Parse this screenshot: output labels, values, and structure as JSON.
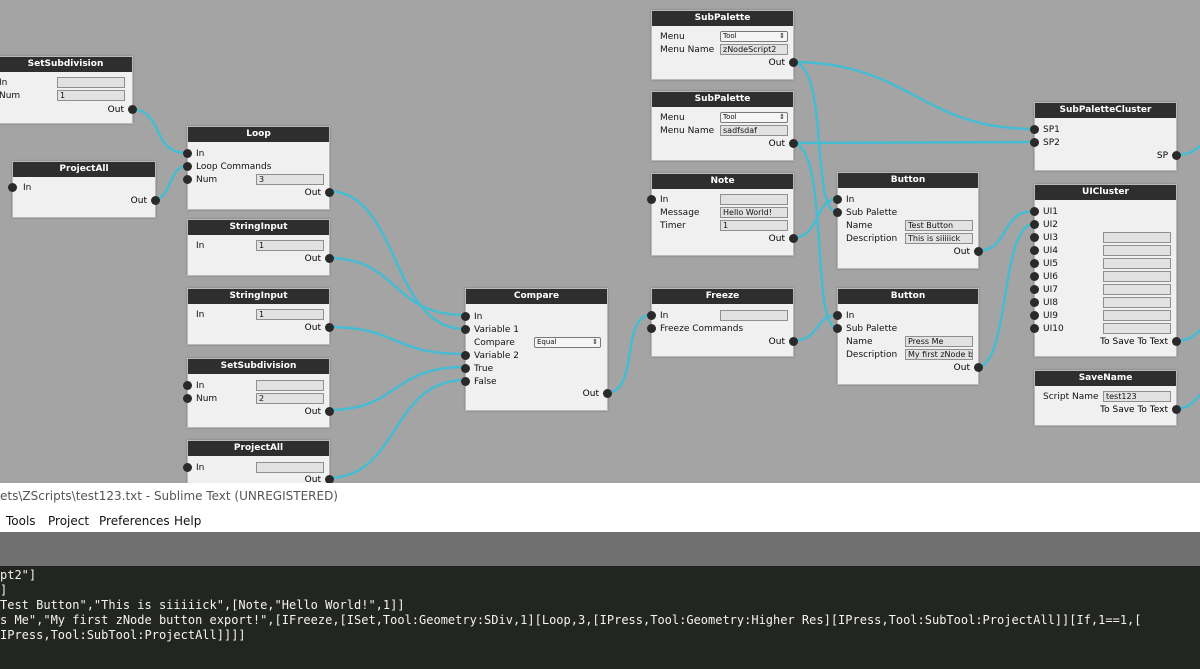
{
  "graph": {
    "nodes": {
      "setsub1": {
        "title": "SetSubdivision",
        "in": "In",
        "num": "Num",
        "num_value": "1",
        "out": "Out"
      },
      "projectall1": {
        "title": "ProjectAll",
        "in": "In",
        "out": "Out"
      },
      "loop": {
        "title": "Loop",
        "in": "In",
        "commands": "Loop Commands",
        "num": "Num",
        "num_value": "3",
        "out": "Out"
      },
      "strinput1": {
        "title": "StringInput",
        "in": "In",
        "in_value": "1",
        "out": "Out"
      },
      "strinput2": {
        "title": "StringInput",
        "in": "In",
        "in_value": "1",
        "out": "Out"
      },
      "setsub2": {
        "title": "SetSubdivision",
        "in": "In",
        "num": "Num",
        "num_value": "2",
        "out": "Out"
      },
      "projectall2": {
        "title": "ProjectAll",
        "in": "In",
        "out": "Out"
      },
      "compare": {
        "title": "Compare",
        "in": "In",
        "var1": "Variable 1",
        "compare": "Compare",
        "compare_value": "Equal",
        "var2": "Variable 2",
        "true_lbl": "True",
        "false_lbl": "False",
        "out": "Out"
      },
      "subpalette1": {
        "title": "SubPalette",
        "menu": "Menu",
        "menu_value": "Tool",
        "menu_name": "Menu Name",
        "menu_name_value": "zNodeScript2",
        "out": "Out"
      },
      "subpalette2": {
        "title": "SubPalette",
        "menu": "Menu",
        "menu_value": "Tool",
        "menu_name": "Menu Name",
        "menu_name_value": "sadfsdaf",
        "out": "Out"
      },
      "note": {
        "title": "Note",
        "in": "In",
        "message": "Message",
        "message_value": "Hello World!",
        "timer": "Timer",
        "timer_value": "1",
        "out": "Out"
      },
      "freeze": {
        "title": "Freeze",
        "in": "In",
        "commands": "Freeze Commands",
        "out": "Out"
      },
      "button1": {
        "title": "Button",
        "in": "In",
        "subpalette": "Sub Palette",
        "name": "Name",
        "name_value": "Test Button",
        "desc": "Description",
        "desc_value": "This is siiiiick",
        "out": "Out"
      },
      "button2": {
        "title": "Button",
        "in": "In",
        "subpalette": "Sub Palette",
        "name": "Name",
        "name_value": "Press Me",
        "desc": "Description",
        "desc_value": "My first zNode b",
        "out": "Out"
      },
      "spcluster": {
        "title": "SubPaletteCluster",
        "sp1": "SP1",
        "sp2": "SP2",
        "out": "SP"
      },
      "uicluster": {
        "title": "UICluster",
        "inputs": [
          "UI1",
          "UI2",
          "UI3",
          "UI4",
          "UI5",
          "UI6",
          "UI7",
          "UI8",
          "UI9",
          "UI10"
        ],
        "out": "To Save To Text"
      },
      "savename": {
        "title": "SaveName",
        "script": "Script Name",
        "script_value": "test123",
        "out": "To Save To Text"
      }
    }
  },
  "window": {
    "title": "ets\\ZScripts\\test123.txt - Sublime Text (UNREGISTERED)"
  },
  "menu": {
    "items": [
      "Tools",
      "Project",
      "Preferences",
      "Help"
    ]
  },
  "editor": {
    "lines": [
      "pt2\"]",
      "]",
      "Test Button\",\"This is siiiiick\",[Note,\"Hello World!\",1]]",
      "s Me\",\"My first zNode button export!\",[IFreeze,[ISet,Tool:Geometry:SDiv,1][Loop,3,[IPress,Tool:Geometry:Higher Res][IPress,Tool:SubTool:ProjectAll]][If,1==1,[",
      "IPress,Tool:SubTool:ProjectAll]]]]"
    ]
  },
  "colors": {
    "wire": "#46bcd3",
    "node_title": "#2e2e2e",
    "node_body": "#f0f0f0",
    "canvas": "#a4a4a4",
    "editor_bg": "#232520"
  }
}
